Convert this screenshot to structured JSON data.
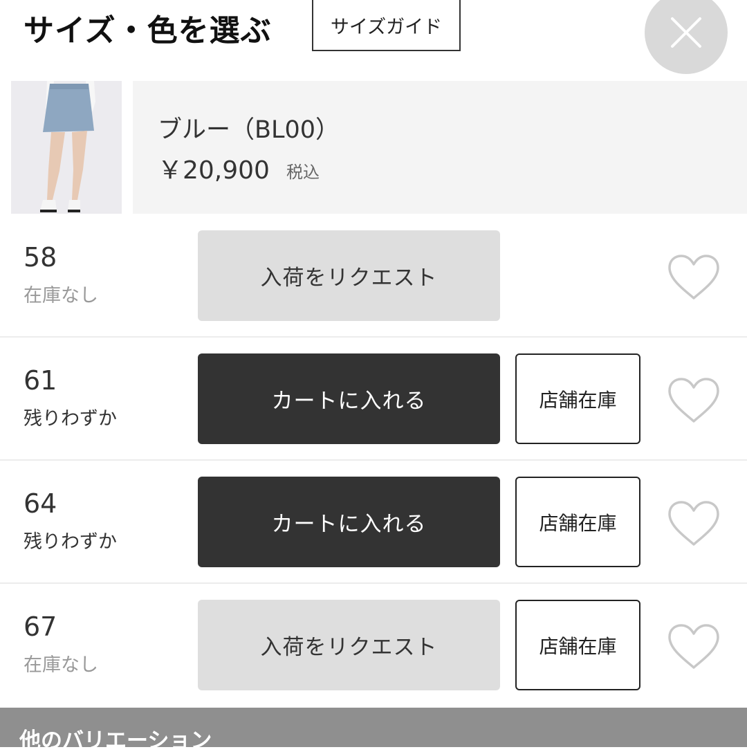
{
  "header": {
    "title": "サイズ・色を選ぶ",
    "size_guide_label": "サイズガイド",
    "close_icon": "close-icon"
  },
  "product": {
    "image_icon": "skirt-product-photo",
    "color_name": "ブルー（BL00）",
    "price": "￥20,900",
    "tax_label": "税込"
  },
  "sizes": [
    {
      "size": "58",
      "stock": "在庫なし",
      "stock_state": "none",
      "action_label": "入荷をリクエスト",
      "action_type": "request",
      "store_label": null,
      "favorite_icon": "heart-outline-icon"
    },
    {
      "size": "61",
      "stock": "残りわずか",
      "stock_state": "few",
      "action_label": "カートに入れる",
      "action_type": "cart",
      "store_label": "店舗在庫",
      "favorite_icon": "heart-outline-icon"
    },
    {
      "size": "64",
      "stock": "残りわずか",
      "stock_state": "few",
      "action_label": "カートに入れる",
      "action_type": "cart",
      "store_label": "店舗在庫",
      "favorite_icon": "heart-outline-icon"
    },
    {
      "size": "67",
      "stock": "在庫なし",
      "stock_state": "none",
      "action_label": "入荷をリクエスト",
      "action_type": "request",
      "store_label": "店舗在庫",
      "favorite_icon": "heart-outline-icon"
    }
  ],
  "variations": {
    "label": "他のバリエーション"
  },
  "colors": {
    "cart_button": "#333333",
    "request_button": "#dedede",
    "variations_bar": "#8f8f8f",
    "close_button": "#d9d9d9"
  }
}
